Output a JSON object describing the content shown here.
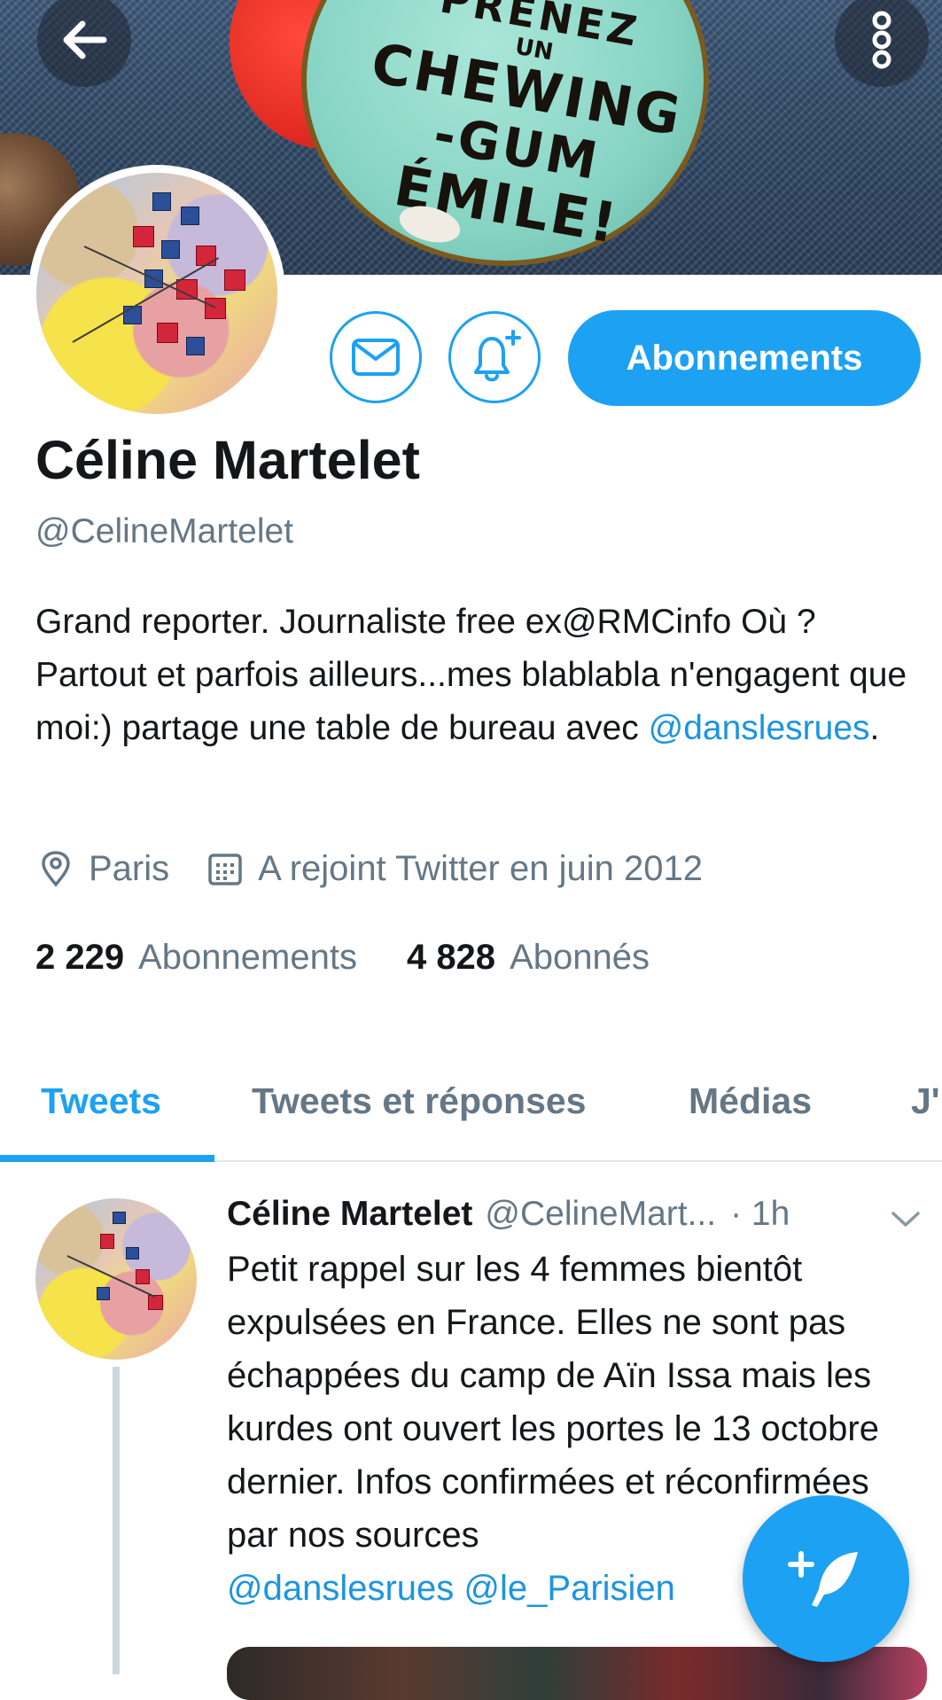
{
  "banner": {
    "pin_text": [
      "PRENEZ",
      "UN",
      "CHEWING",
      "-GUM",
      "ÉMILE!"
    ],
    "colors": {
      "denim": "#3f5a7c",
      "pin": "#87d4c4",
      "accent_red": "#e02b23"
    }
  },
  "toolbar": {
    "back_icon": "arrow-left-icon",
    "more_icon": "more-vertical-icon"
  },
  "profile": {
    "display_name": "Céline Martelet",
    "handle": "@CelineMartelet",
    "bio_text": "Grand reporter. Journaliste free ex@RMCinfo Où ? Partout et parfois ailleurs...mes blablabla n'engagent que moi:) partage une table de bureau avec ",
    "bio_mention": "@danslesrues",
    "bio_end": ".",
    "location": "Paris",
    "joined": "A rejoint Twitter en juin 2012",
    "following_count": "2 229",
    "following_label": "Abonnements",
    "followers_count": "4 828",
    "followers_label": "Abonnés"
  },
  "actions": {
    "message_icon": "envelope-icon",
    "notify_icon": "bell-plus-icon",
    "follow_label": "Abonnements"
  },
  "tabs": [
    {
      "label": "Tweets",
      "active": true
    },
    {
      "label": "Tweets et réponses",
      "active": false
    },
    {
      "label": "Médias",
      "active": false
    },
    {
      "label": "J'",
      "active": false
    }
  ],
  "tweet": {
    "author_name": "Céline Martelet",
    "author_handle": "@CelineMart...",
    "time": "· 1h",
    "text": "Petit rappel sur les 4 femmes bientôt expulsées en France. Elles ne sont pas échappées du camp de Aïn Issa mais les kurdes ont ouvert les portes le 13 octobre dernier. Infos confirmées et réconfirmées par nos sources",
    "mention_1": "@danslesrues",
    "mention_2": "@le_Parisien"
  },
  "fab": {
    "icon": "compose-feather-icon"
  },
  "colors": {
    "accent": "#1da1f2",
    "link": "#1b95e0",
    "secondary_text": "#657786",
    "primary_text": "#14171a"
  }
}
